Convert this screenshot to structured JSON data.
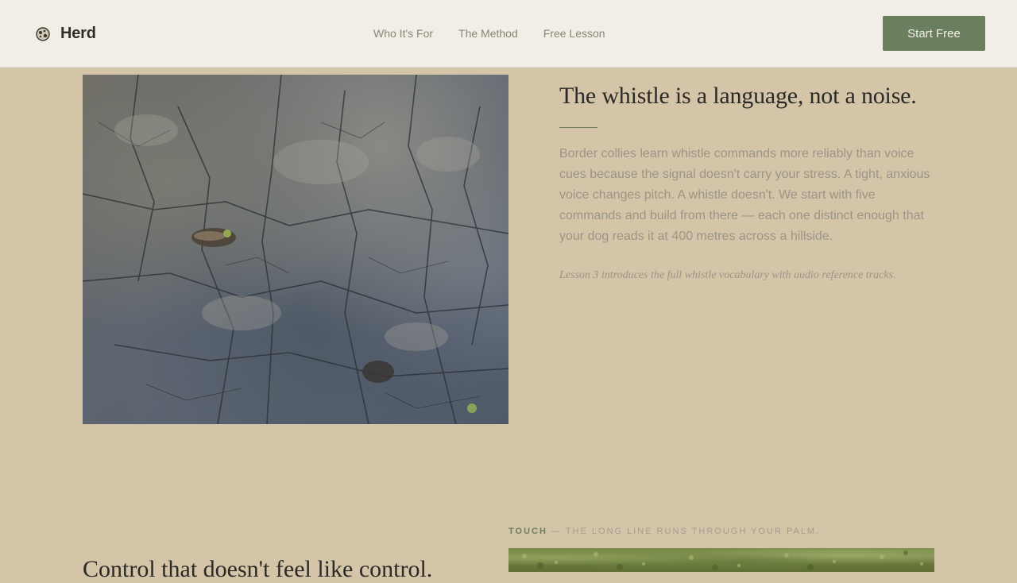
{
  "header": {
    "brand_name": "Herd",
    "nav": [
      "Who It's For",
      "The Method",
      "Free Lesson"
    ],
    "cta_label": "Start Free"
  },
  "whistle_section": {
    "title": "The whistle is a language, not a noise.",
    "body": "Border collies learn whistle commands more reliably than voice cues because the signal doesn't carry your stress. A tight, anxious voice changes pitch. A whistle doesn't. We start with five commands and build from there — each one distinct enough that your dog reads it at 400 metres across a hillside.",
    "note": "Lesson 3 introduces the full whistle vocabulary with audio reference tracks."
  },
  "touch_section": {
    "caption_key": "TOUCH",
    "caption_rest": " — THE LONG LINE RUNS THROUGH YOUR PALM.",
    "title": "Control that doesn't feel like control."
  },
  "colors": {
    "page_bg": "#d4c5a8",
    "accent": "#6b7f5e",
    "header_bg": "#f3efe7"
  }
}
